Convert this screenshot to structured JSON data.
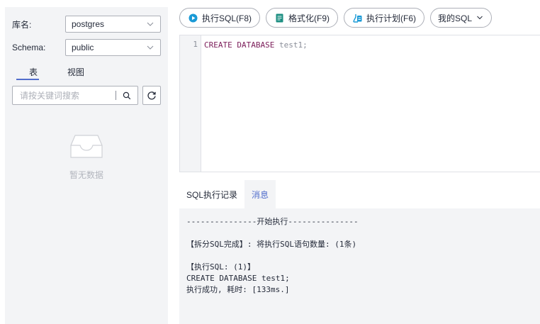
{
  "sidebar": {
    "db_label": "库名:",
    "db_value": "postgres",
    "schema_label": "Schema:",
    "schema_value": "public",
    "tabs": [
      {
        "label": "表",
        "active": true
      },
      {
        "label": "视图",
        "active": false
      }
    ],
    "search_placeholder": "请按关键词搜索",
    "empty_text": "暂无数据"
  },
  "toolbar": {
    "execute_label": "执行SQL(F8)",
    "format_label": "格式化(F9)",
    "plan_label": "执行计划(F6)",
    "my_sql_label": "我的SQL"
  },
  "editor": {
    "line_number": "1",
    "keyword_1": "CREATE",
    "keyword_2": "DATABASE",
    "identifier": "test1;"
  },
  "result_tabs": [
    {
      "label": "SQL执行记录",
      "active": false
    },
    {
      "label": "消息",
      "active": true
    }
  ],
  "output": {
    "line_1": "---------------开始执行---------------",
    "line_2": "【拆分SQL完成】: 将执行SQL语句数量: (1条)",
    "line_3": "【执行SQL: (1)】",
    "line_4": "CREATE DATABASE test1;",
    "line_5": "执行成功, 耗时: [133ms.]"
  },
  "colors": {
    "accent": "#526ecc",
    "panel_bg": "#f3f4f6",
    "keyword": "#7b1c59",
    "play_icon": "#1a9ad6",
    "format_icon": "#1d8f82",
    "plan_icon": "#1a9ad6"
  },
  "icons": {
    "execute": "play-circle-icon",
    "format": "format-doc-icon",
    "plan": "plan-icon",
    "my_sql": "chevron-down-icon",
    "search": "search-icon",
    "refresh": "refresh-icon",
    "empty": "empty-tray-icon"
  }
}
